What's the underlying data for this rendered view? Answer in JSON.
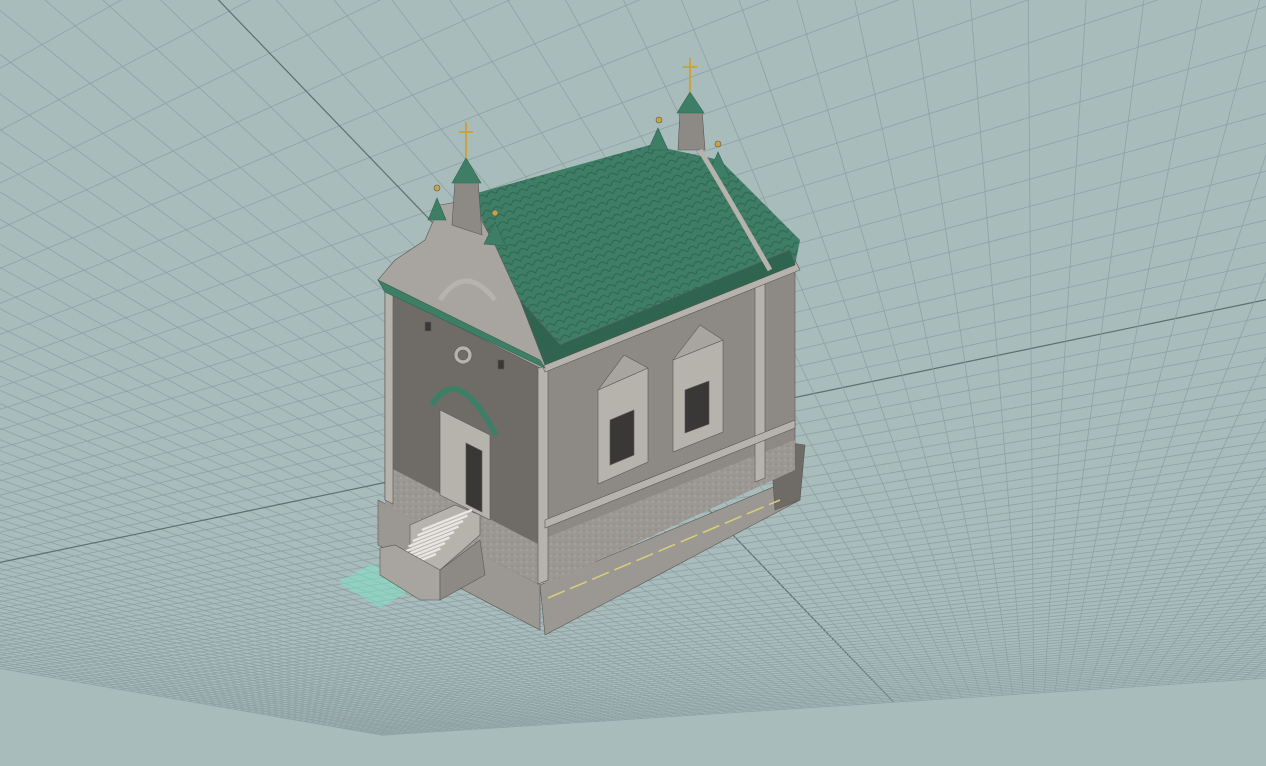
{
  "viewport": {
    "background_color": "#a9bcbc",
    "grid_color": "#8fa1a2",
    "axis_color": "#5f6f70",
    "grid_visible": true
  },
  "model": {
    "roof_color": "#3f7e66",
    "roof_shadow_color": "#2f6450",
    "wall_color": "#8d8a86",
    "wall_light_color": "#a8a5a0",
    "wall_dark_color": "#6f6c68",
    "plinth_color": "#9b9893",
    "trim_color": "#b6b2ac",
    "cross_color": "#c9a342",
    "highlight_color": "#7fe0c4",
    "icons": [
      "chapel-model",
      "ground-grid",
      "selection-highlight"
    ]
  }
}
